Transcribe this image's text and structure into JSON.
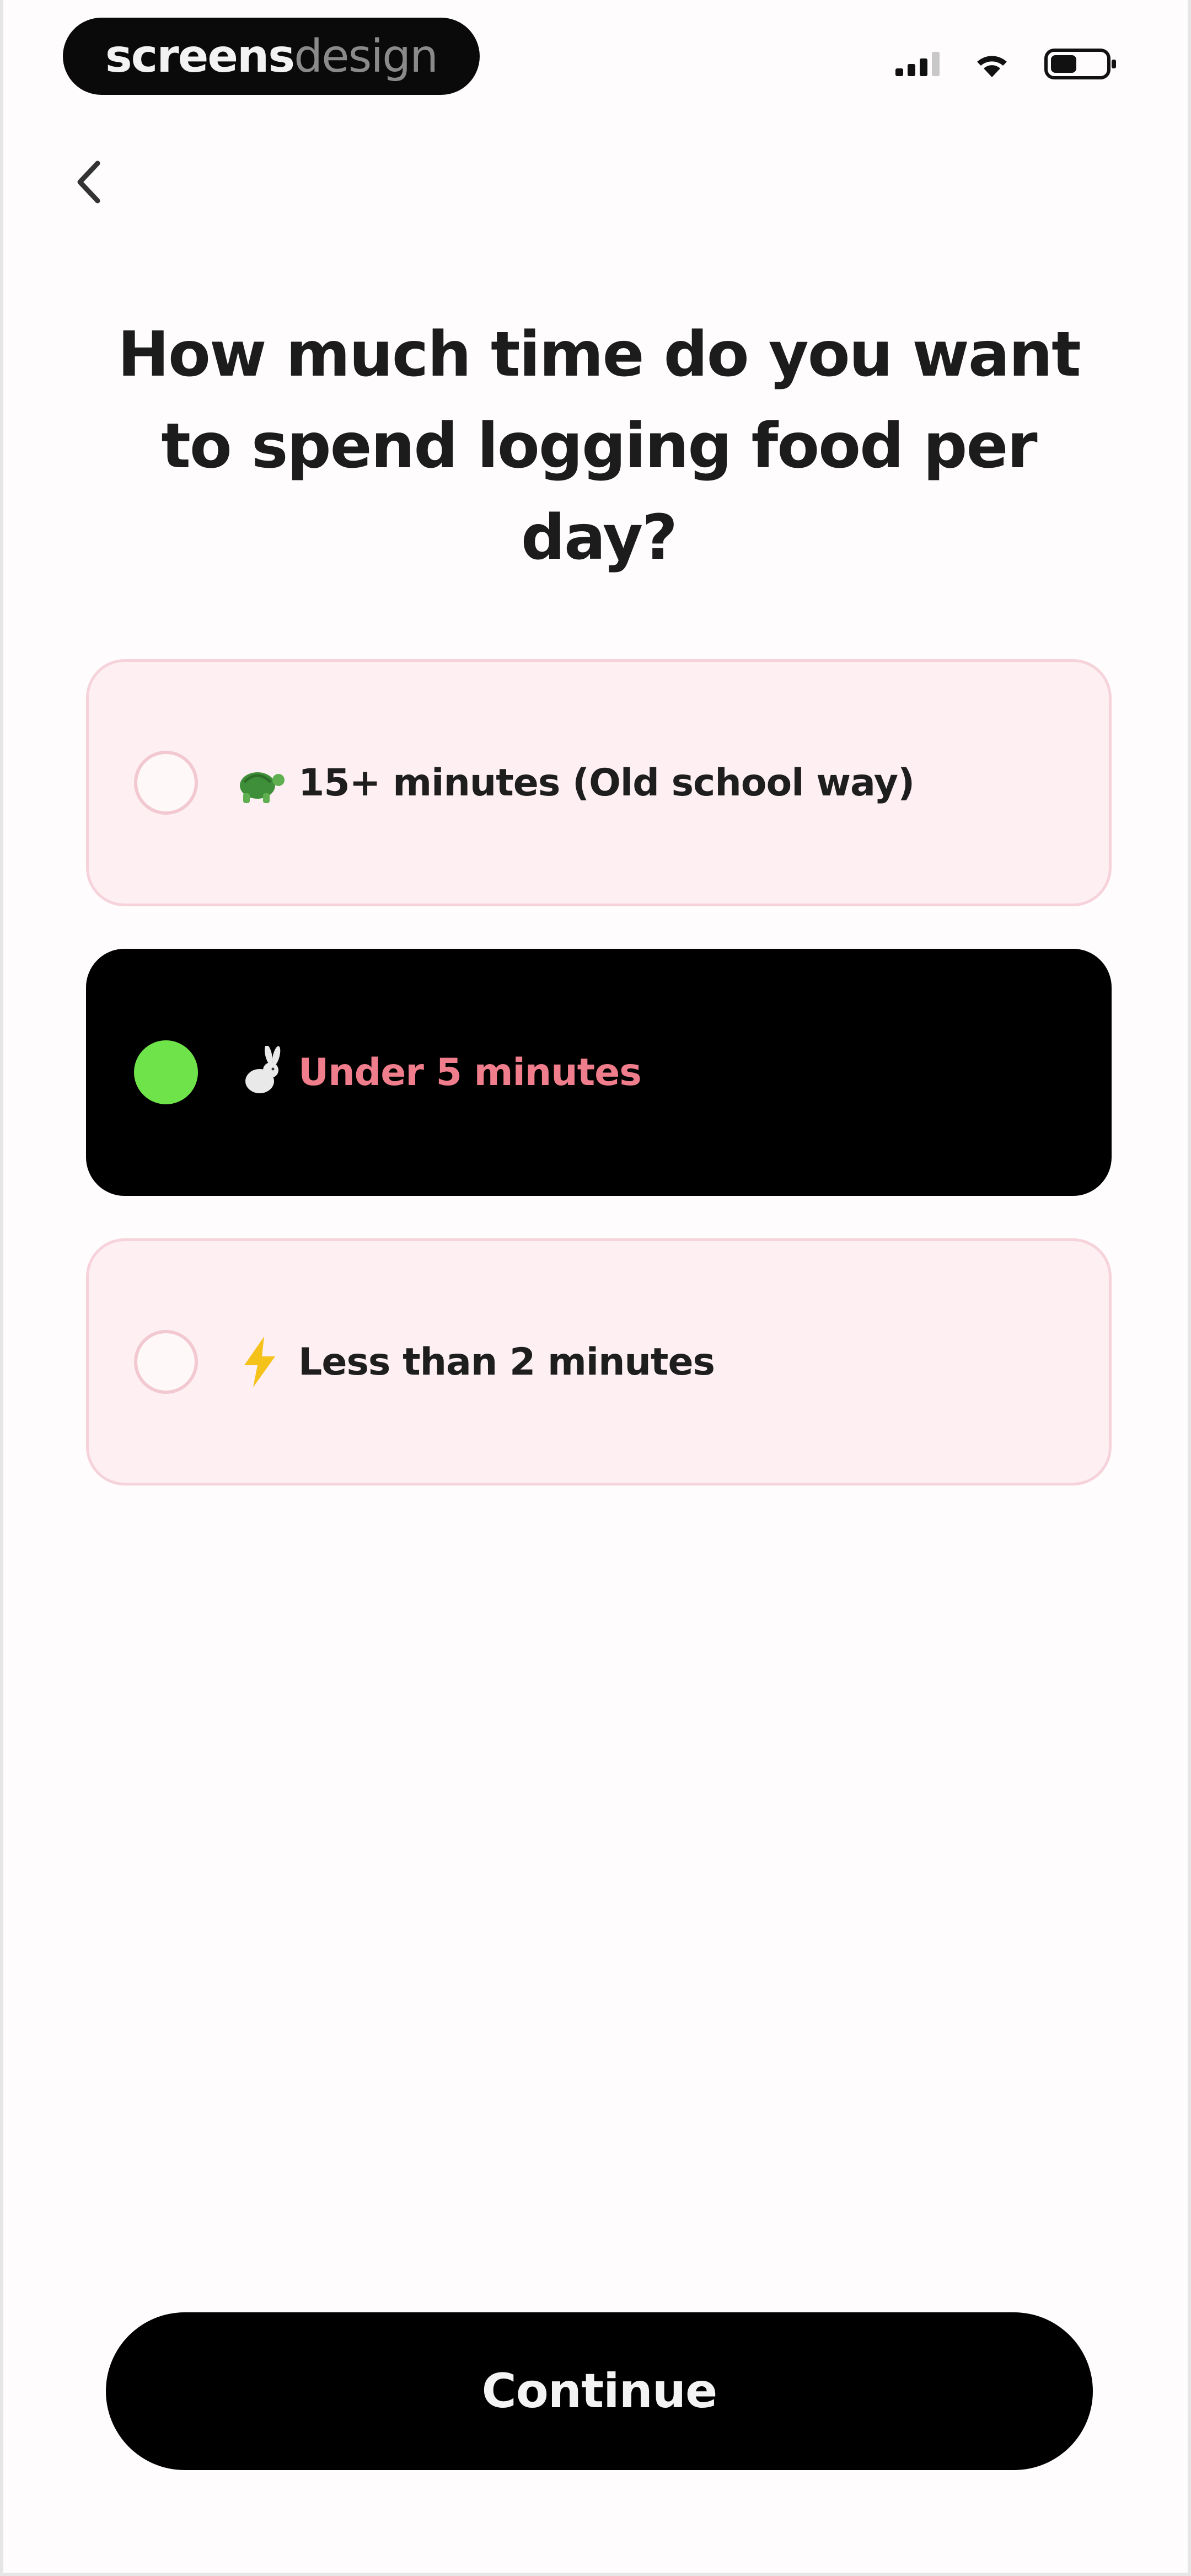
{
  "status_bar": {
    "brand_part1": "screens",
    "brand_part2": "design",
    "icons": [
      "cellular-signal-icon",
      "wifi-icon",
      "battery-icon"
    ]
  },
  "nav": {
    "back_icon": "chevron-left-icon"
  },
  "question": {
    "text": "How much time do you want to spend logging food per day?"
  },
  "options": [
    {
      "icon": "turtle-icon",
      "label": "15+ minutes (Old school way)",
      "selected": false
    },
    {
      "icon": "rabbit-icon",
      "label": "Under 5 minutes",
      "selected": true
    },
    {
      "icon": "lightning-icon",
      "label": "Less than 2 minutes",
      "selected": false
    }
  ],
  "footer": {
    "continue_label": "Continue"
  },
  "colors": {
    "background": "#fefcfd",
    "option_bg": "#fdeff2",
    "option_border": "#f6d3da",
    "selected_bg": "#000000",
    "selected_radio": "#6fe34a",
    "selected_label": "#f07d8b",
    "button_bg": "#000000"
  }
}
